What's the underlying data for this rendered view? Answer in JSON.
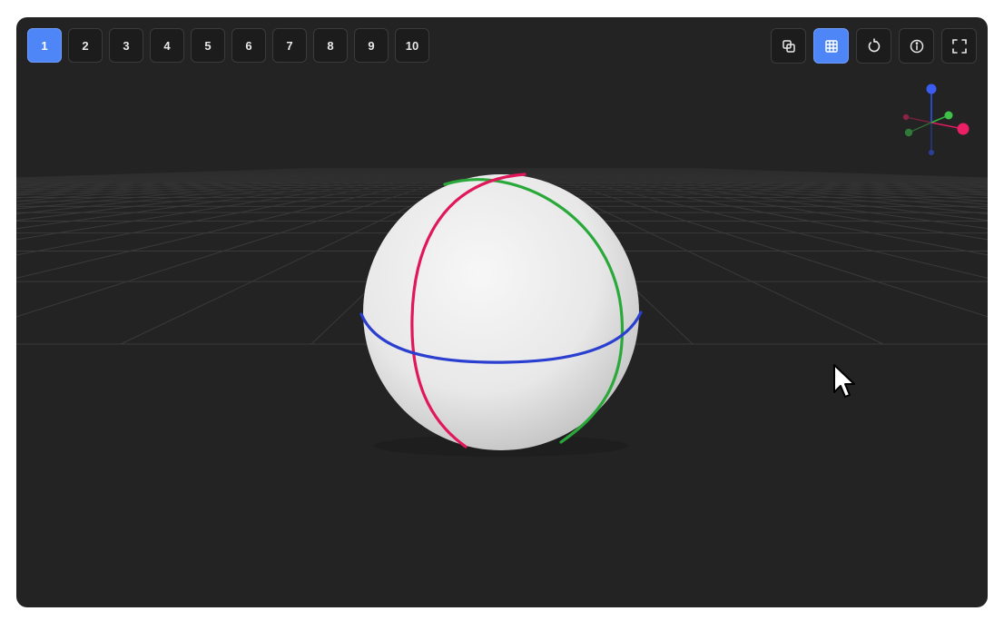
{
  "scene_buttons": [
    {
      "label": "1",
      "active": true
    },
    {
      "label": "2",
      "active": false
    },
    {
      "label": "3",
      "active": false
    },
    {
      "label": "4",
      "active": false
    },
    {
      "label": "5",
      "active": false
    },
    {
      "label": "6",
      "active": false
    },
    {
      "label": "7",
      "active": false
    },
    {
      "label": "8",
      "active": false
    },
    {
      "label": "9",
      "active": false
    },
    {
      "label": "10",
      "active": false
    }
  ],
  "controls": [
    {
      "icon": "copy-squares-icon",
      "active": false
    },
    {
      "icon": "grid-icon",
      "active": true
    },
    {
      "icon": "rotate-reset-icon",
      "active": false
    },
    {
      "icon": "info-icon",
      "active": false
    },
    {
      "icon": "fullscreen-icon",
      "active": false
    }
  ],
  "colors": {
    "background": "#232323",
    "grid": "#3a3a3a",
    "accent": "#4f86f7",
    "sphere": "#ececec",
    "axis_x": "#e0185a",
    "axis_y": "#2aa83a",
    "axis_z": "#2a3fcf"
  },
  "grid_visible": true
}
